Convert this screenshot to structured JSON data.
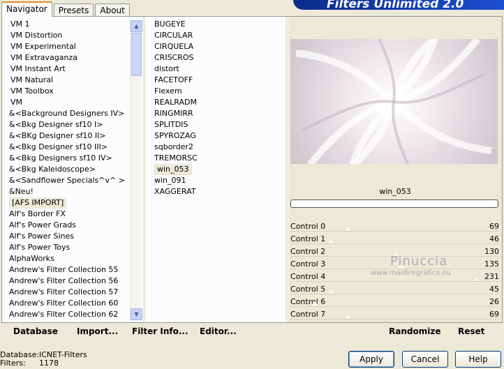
{
  "header": {
    "title": "Filters Unlimited 2.0"
  },
  "tabs": [
    {
      "label": "Navigator",
      "active": true
    },
    {
      "label": "Presets",
      "active": false
    },
    {
      "label": "About",
      "active": false
    }
  ],
  "categories": [
    "VM 1",
    "VM Distortion",
    "VM Experimental",
    "VM Extravaganza",
    "VM Instant Art",
    "VM Natural",
    "VM Toolbox",
    "VM",
    "&<Background Designers IV>",
    "&<Bkg Designer sf10 I>",
    "&<BKg Designer sf10 II>",
    "&<Bkg Designer sf10 III>",
    "&<Bkg Designers sf10 IV>",
    "&<Bkg Kaleidoscope>",
    "&<Sandflower Specials^v^ >",
    "&Neu!",
    "[AFS IMPORT]",
    "Alf's Border FX",
    "Alf's Power Grads",
    "Alf's Power Sines",
    "Alf's Power Toys",
    "AlphaWorks",
    "Andrew's Filter Collection 55",
    "Andrew's Filter Collection 56",
    "Andrew's Filter Collection 57",
    "Andrew's Filter Collection 60",
    "Andrew's Filter Collection 62"
  ],
  "selected_category": "[AFS IMPORT]",
  "filters": [
    "BUGEYE",
    "CIRCULAR",
    "CIRQUELA",
    "CRISCROS",
    "distort",
    "FACETOFF",
    "Flexem",
    "REALRADM",
    "RINGMIRR",
    "SPLITDIS",
    "SPYROZAG",
    "sqborder2",
    "TREMORSC",
    "win_053",
    "win_091",
    "XAGGERAT"
  ],
  "selected_filter": "win_053",
  "preview": {
    "filter_name": "win_053"
  },
  "controls": [
    {
      "label": "Control 0",
      "value": "69",
      "fraction": 0.27
    },
    {
      "label": "Control 1",
      "value": "46",
      "fraction": 0.18
    },
    {
      "label": "Control 2",
      "value": "130",
      "fraction": 0.51
    },
    {
      "label": "Control 3",
      "value": "135",
      "fraction": 0.53
    },
    {
      "label": "Control 4",
      "value": "231",
      "fraction": 0.91
    },
    {
      "label": "Control 5",
      "value": "45",
      "fraction": 0.18
    },
    {
      "label": "Control 6",
      "value": "26",
      "fraction": 0.1
    },
    {
      "label": "Control 7",
      "value": "69",
      "fraction": 0.27
    }
  ],
  "watermark": {
    "name": "Pinuccia",
    "site": "www.maidiregrafica.eu"
  },
  "toolbar": {
    "database": "Database",
    "import": "Import...",
    "filter_info": "Filter Info...",
    "editor": "Editor...",
    "randomize": "Randomize",
    "reset": "Reset"
  },
  "status": {
    "database_key": "Database:",
    "database_value": "ICNET-Filters",
    "filters_key": "Filters:",
    "filters_value": "1178"
  },
  "buttons": {
    "apply": "Apply",
    "cancel": "Cancel",
    "help": "Help"
  },
  "colors": {
    "background": "#ece9d8",
    "banner": "#0a2a8c",
    "tab_highlight": "#e68b2c"
  }
}
